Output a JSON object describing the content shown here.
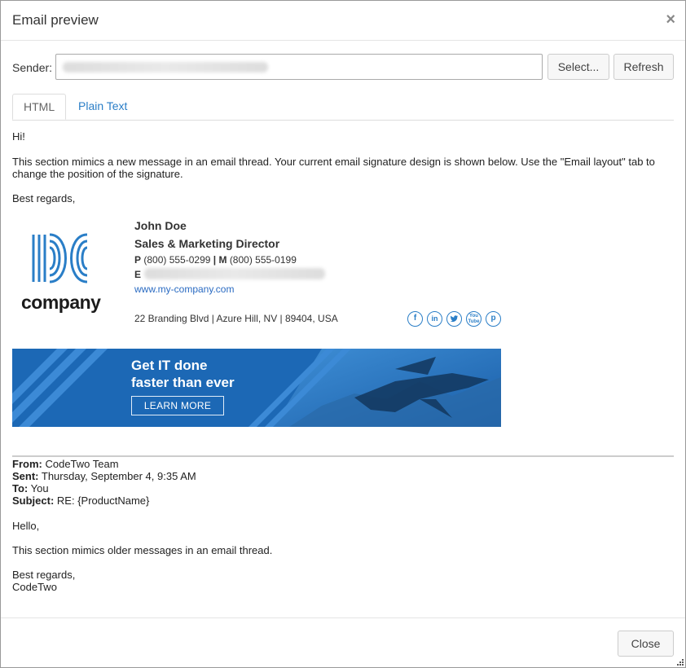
{
  "dialog": {
    "title": "Email preview",
    "close_glyph": "×"
  },
  "sender": {
    "label": "Sender:",
    "value": ""
  },
  "buttons": {
    "select": "Select...",
    "refresh": "Refresh",
    "close": "Close"
  },
  "tabs": [
    {
      "label": "HTML",
      "active": true
    },
    {
      "label": "Plain Text",
      "active": false
    }
  ],
  "message": {
    "greeting": "Hi!",
    "body_line1": "This section mimics a new message in an email thread. Your current email signature design is shown below. Use the \"Email layout\" tab to",
    "body_line2": "change the position of the signature.",
    "closing": "Best regards,"
  },
  "signature": {
    "logo_text": "company",
    "name": "John Doe",
    "job_title": "Sales & Marketing Director",
    "phone_label": "P",
    "phone": "(800) 555-0299",
    "separator": "|",
    "mobile_label": "M",
    "mobile": "(800) 555-0199",
    "email_label": "E",
    "website": "www.my-company.com",
    "address": "22 Branding Blvd | Azure Hill, NV | 89404, USA",
    "social_icons": [
      "facebook-icon",
      "linkedin-icon",
      "twitter-icon",
      "youtube-icon",
      "pinterest-icon"
    ],
    "brand_color": "#2a7ec7"
  },
  "banner": {
    "line1": "Get IT done",
    "line2": "faster than ever",
    "cta": "LEARN MORE"
  },
  "quoted": {
    "from_label": "From:",
    "from": "CodeTwo Team",
    "sent_label": "Sent:",
    "sent": "Thursday, September 4, 9:35 AM",
    "to_label": "To:",
    "to": "You",
    "subject_label": "Subject:",
    "subject": "RE: {ProductName}",
    "hello": "Hello,",
    "body": "This section mimics older messages in an email thread.",
    "closing1": "Best regards,",
    "closing2": "CodeTwo"
  }
}
